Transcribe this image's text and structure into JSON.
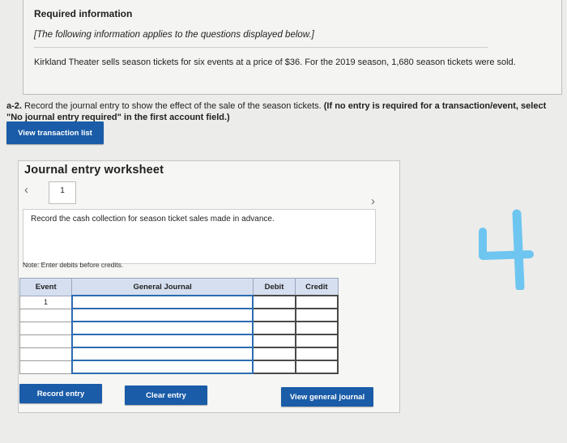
{
  "required": {
    "title": "Required information",
    "italic_note": "[The following information applies to the questions displayed below.]",
    "text": "Kirkland Theater sells season tickets for six events at a price of $36. For the 2019 season, 1,680 season tickets were sold."
  },
  "question": {
    "number": "a-2.",
    "text": " Record the journal entry to show the effect of the sale of the season tickets. ",
    "bold_note": "(If no entry is required for a transaction/event, select \"No journal entry required\" in the first account field.)"
  },
  "buttons": {
    "view_transaction_list": "View transaction list",
    "record_entry": "Record entry",
    "clear_entry": "Clear entry",
    "view_general_journal": "View general journal"
  },
  "worksheet": {
    "title": "Journal entry worksheet",
    "current_page": "1",
    "description": "Record the cash collection for season ticket sales made in advance.",
    "note": "Note: Enter debits before credits.",
    "columns": [
      "Event",
      "General Journal",
      "Debit",
      "Credit"
    ],
    "rows": [
      {
        "event": "1",
        "account": "",
        "debit": "",
        "credit": ""
      },
      {
        "event": "",
        "account": "",
        "debit": "",
        "credit": ""
      },
      {
        "event": "",
        "account": "",
        "debit": "",
        "credit": ""
      },
      {
        "event": "",
        "account": "",
        "debit": "",
        "credit": ""
      },
      {
        "event": "",
        "account": "",
        "debit": "",
        "credit": ""
      },
      {
        "event": "",
        "account": "",
        "debit": "",
        "credit": ""
      }
    ]
  },
  "colors": {
    "button_blue": "#1a5ca8",
    "header_blue": "#d6dff0",
    "scribble_cyan": "#6ec6f0"
  }
}
